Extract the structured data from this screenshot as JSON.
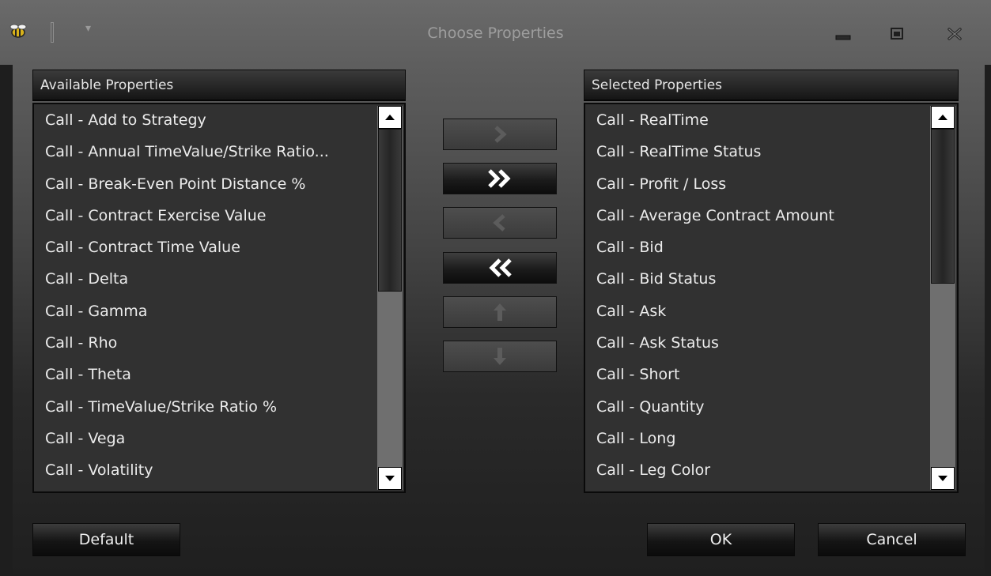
{
  "window": {
    "title": "Choose Properties",
    "app_icon": "bee-icon",
    "quick_access_icon": "dropdown-arrow-icon"
  },
  "available": {
    "header": "Available Properties",
    "items": [
      "Call - Add to Strategy",
      "Call - Annual TimeValue/Strike Ratio...",
      "Call - Break-Even Point Distance %",
      "Call - Contract Exercise Value",
      "Call - Contract Time Value",
      "Call - Delta",
      "Call - Gamma",
      "Call - Rho",
      "Call - Theta",
      "Call - TimeValue/Strike Ratio %",
      "Call - Vega",
      "Call - Volatility"
    ]
  },
  "selected": {
    "header": "Selected Properties",
    "items": [
      "Call - RealTime",
      "Call - RealTime Status",
      "Call - Profit / Loss",
      "Call - Average Contract Amount",
      "Call - Bid",
      "Call - Bid Status",
      "Call - Ask",
      "Call - Ask Status",
      "Call - Short",
      "Call - Quantity",
      "Call - Long",
      "Call - Leg Color"
    ]
  },
  "transfer_buttons": [
    {
      "name": "add-selected",
      "icon": "chevron-right-icon",
      "enabled": false
    },
    {
      "name": "add-all",
      "icon": "double-chevron-right-icon",
      "enabled": true
    },
    {
      "name": "remove-selected",
      "icon": "chevron-left-icon",
      "enabled": false
    },
    {
      "name": "remove-all",
      "icon": "double-chevron-left-icon",
      "enabled": true
    },
    {
      "name": "move-up",
      "icon": "arrow-up-icon",
      "enabled": false
    },
    {
      "name": "move-down",
      "icon": "arrow-down-icon",
      "enabled": false
    }
  ],
  "buttons": {
    "default": "Default",
    "ok": "OK",
    "cancel": "Cancel"
  },
  "colors": {
    "title_bar": "#626262",
    "list_background": "#313131",
    "text": "#ececec",
    "disabled_glyph": "#5c5c5c",
    "enabled_glyph": "#ffffff"
  }
}
